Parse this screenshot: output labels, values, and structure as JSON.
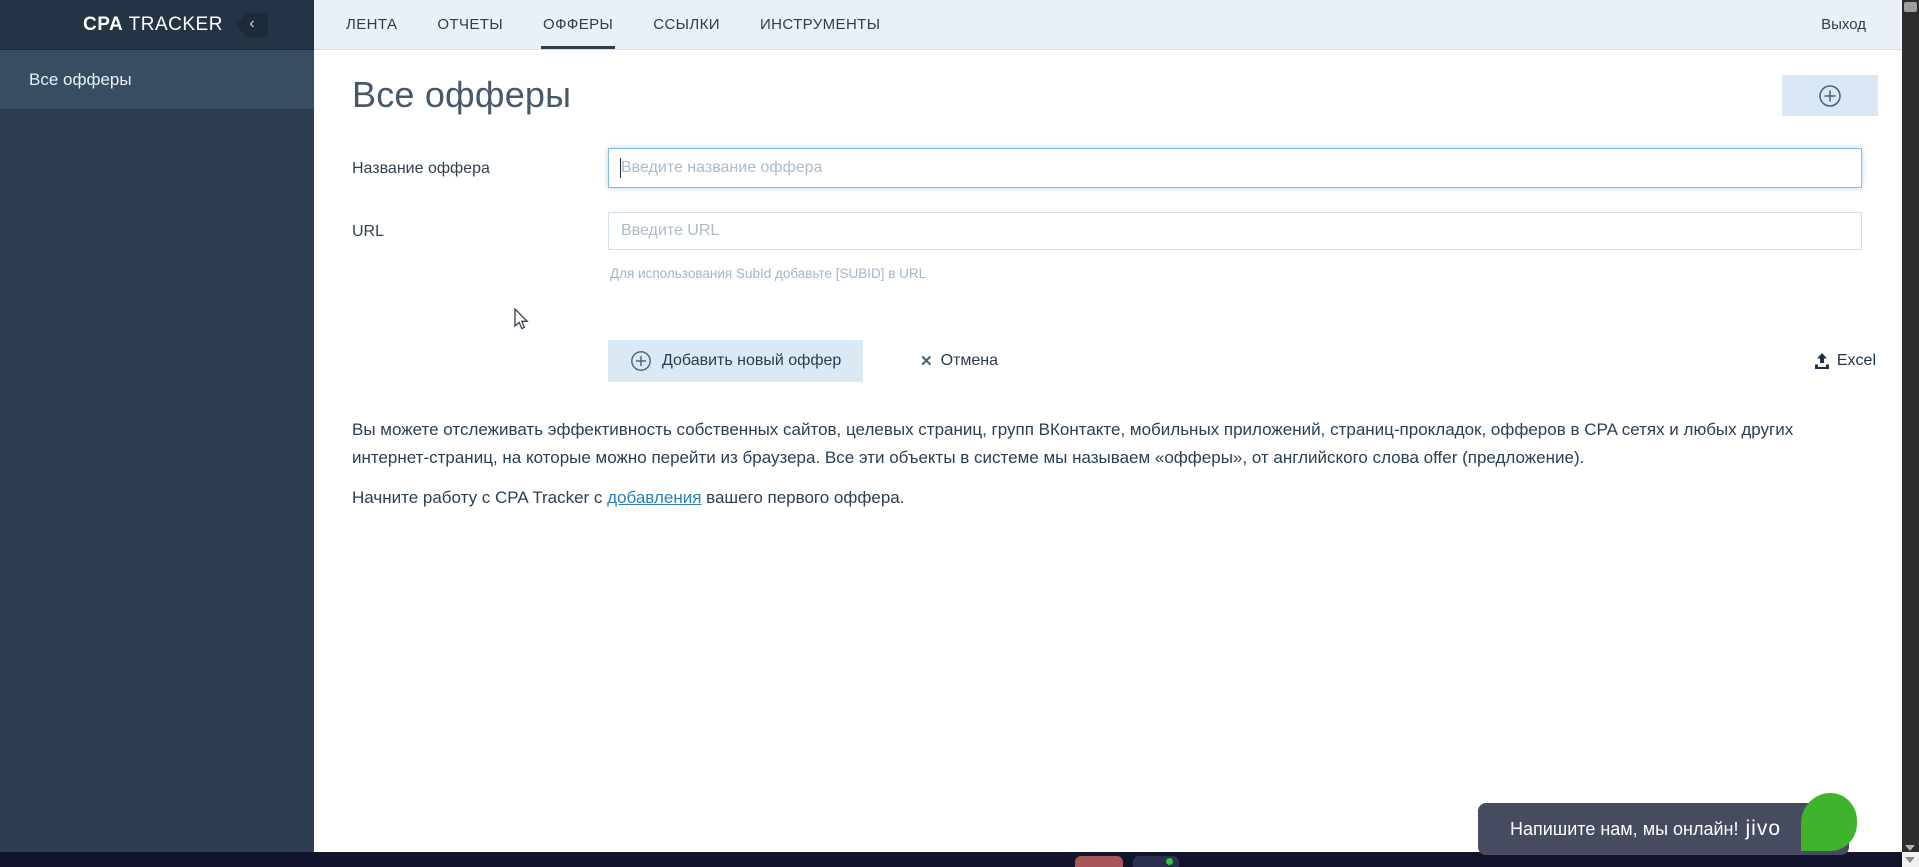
{
  "app": {
    "brand_bold": "CPA",
    "brand_rest": " TRACKER"
  },
  "header": {
    "tabs": [
      {
        "label": "ЛЕНТА",
        "active": false
      },
      {
        "label": "ОТЧЕТЫ",
        "active": false
      },
      {
        "label": "ОФФЕРЫ",
        "active": true
      },
      {
        "label": "ССЫЛКИ",
        "active": false
      },
      {
        "label": "ИНСТРУМЕНТЫ",
        "active": false
      }
    ],
    "logout_label": "Выход",
    "collapse_icon": "‹"
  },
  "sidebar": {
    "items": [
      {
        "label": "Все офферы",
        "active": true
      }
    ]
  },
  "main": {
    "title": "Все офферы",
    "form": {
      "name_label": "Название оффера",
      "name_placeholder": "Введите название оффера",
      "name_value": "",
      "url_label": "URL",
      "url_placeholder": "Введите URL",
      "url_value": "",
      "hint": "Для использования SubId добавьте [SUBID] в URL",
      "submit_label": "Добавить новый оффер",
      "cancel_label": "Отмена",
      "cancel_icon": "✕",
      "excel_label": "Excel"
    },
    "description_p1": "Вы можете отслеживать эффективность собственных сайтов, целевых страниц, групп ВКонтакте, мобильных приложений, страниц-прокладок, офферов в CPA сетях и любых других интернет-страниц, на которые можно перейти из браузера. Все эти объекты в системе мы называем «офферы», от английского слова offer (предложение).",
    "description_p2_before": "Начните работу с CPA Tracker с ",
    "description_p2_link": "добавления",
    "description_p2_after": " вашего первого оффера."
  },
  "chat": {
    "message": "Напишите нам, мы онлайн!",
    "brand": "jivo"
  },
  "icons": {
    "plus_circle": "plus-in-circle",
    "upload": "upload-arrow-tray",
    "chevron_left": "chevron-left",
    "close": "x-cross"
  },
  "colors": {
    "sidebar_bg": "#2c3e50",
    "sidebar_active_bg": "#384d62",
    "header_bg": "#e9f0f7",
    "accent_button_bg": "#dbe9f5",
    "focus_border": "#85bfe6",
    "link": "#2f7fb8",
    "jivo_bg": "#474b60",
    "jivo_green": "#3fb32c",
    "taskbar_bg": "#11142a"
  }
}
